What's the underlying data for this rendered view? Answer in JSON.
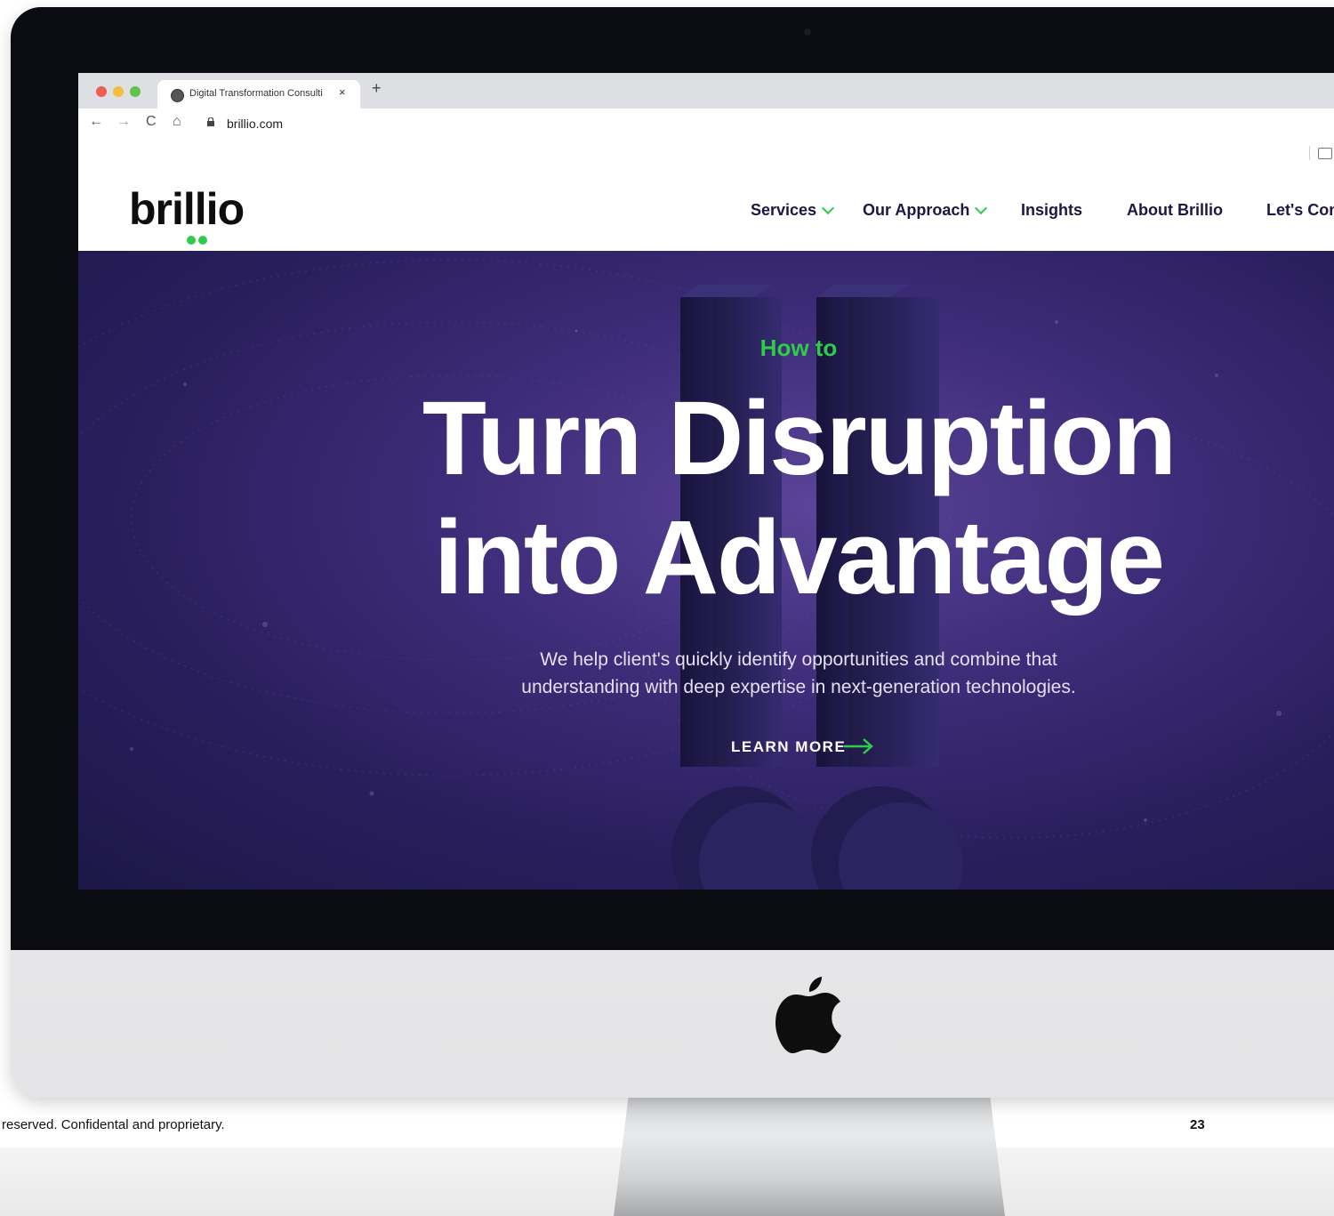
{
  "browser": {
    "tab_title": "Digital Transformation Consulti",
    "tab_close": "×",
    "new_tab": "+",
    "url": "brillio.com",
    "nav_back": "←",
    "nav_forward": "→",
    "nav_reload": "C",
    "nav_home": "⌂"
  },
  "site": {
    "logo_text": "brillio",
    "nav": {
      "services": "Services",
      "our_approach": "Our Approach",
      "insights": "Insights",
      "about": "About Brillio",
      "connect": "Let's Conn"
    }
  },
  "hero": {
    "eyebrow": "How to",
    "headline_line1": "Turn Disruption",
    "headline_line2": "into Advantage",
    "subtext_line1": "We help client's quickly identify opportunities and combine that",
    "subtext_line2": "understanding with deep expertise in next-generation technologies.",
    "cta_label": "LEARN MORE"
  },
  "slide": {
    "footer_note": "reserved. Confidental and proprietary.",
    "page_number": "23"
  },
  "colors": {
    "brand_green": "#2ecc4a",
    "nav_text": "#1b1843",
    "hero_purple": "#3d2c78"
  }
}
